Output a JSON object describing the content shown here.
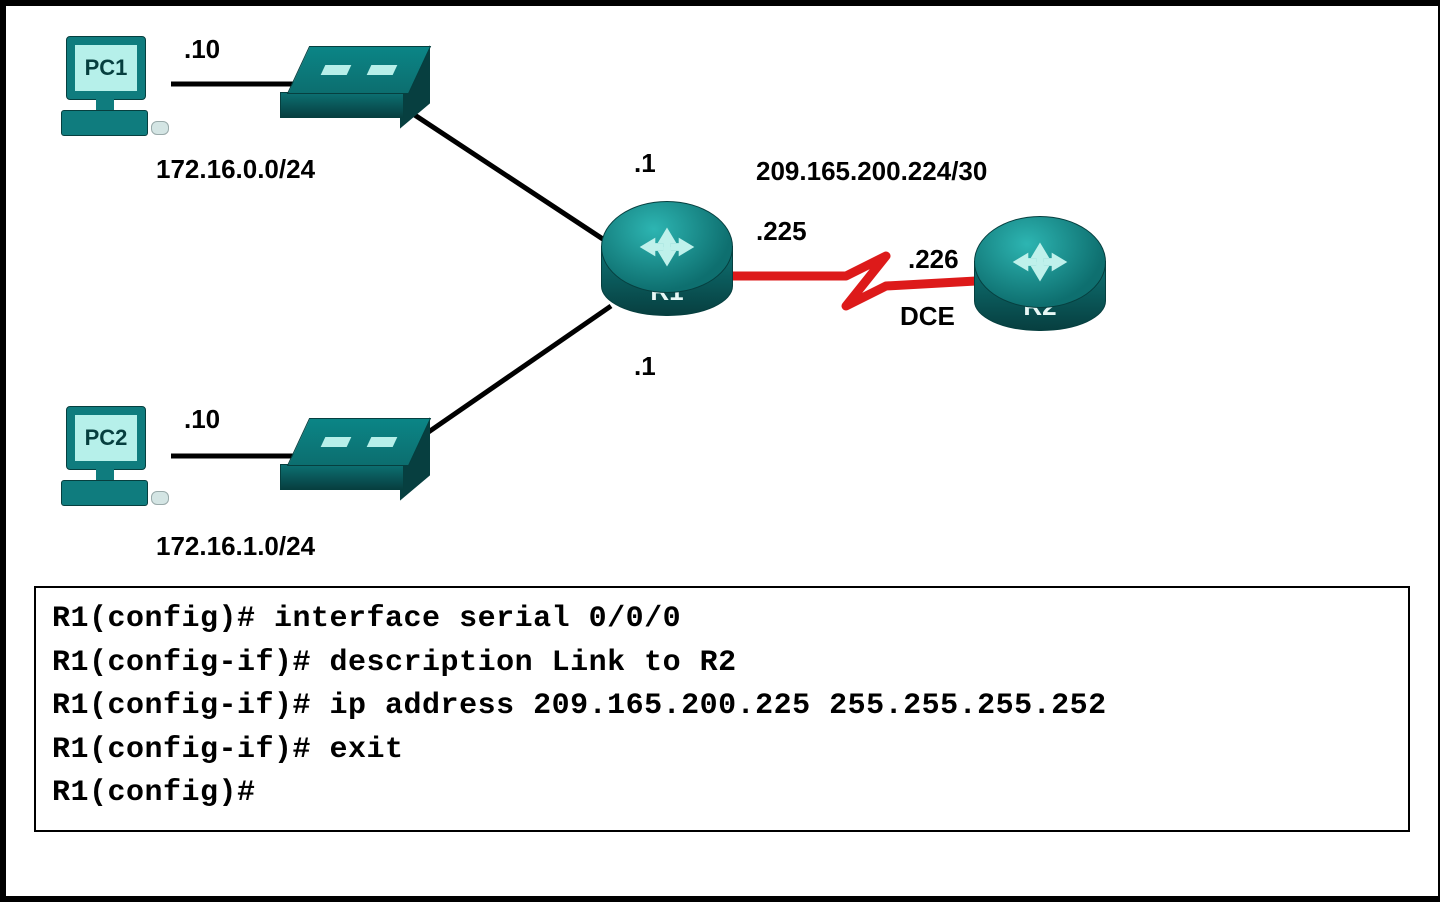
{
  "topology": {
    "pc1": {
      "name": "PC1",
      "hostLabel": ".10",
      "network": "172.16.0.0/24"
    },
    "pc2": {
      "name": "PC2",
      "hostLabel": ".10",
      "network": "172.16.1.0/24"
    },
    "r1": {
      "name": "R1",
      "ifTop": ".1",
      "ifBottom": ".1",
      "wanIp": ".225"
    },
    "r2": {
      "name": "R2",
      "wanIp": ".226",
      "linkLabel": "DCE"
    },
    "wanNetwork": "209.165.200.224/30"
  },
  "terminal": {
    "l1": "R1(config)# interface serial 0/0/0",
    "l2": "R1(config-if)# description Link to R2",
    "l3": "R1(config-if)# ip address 209.165.200.225 255.255.255.252",
    "l4": "R1(config-if)# exit",
    "l5": "R1(config)#"
  }
}
